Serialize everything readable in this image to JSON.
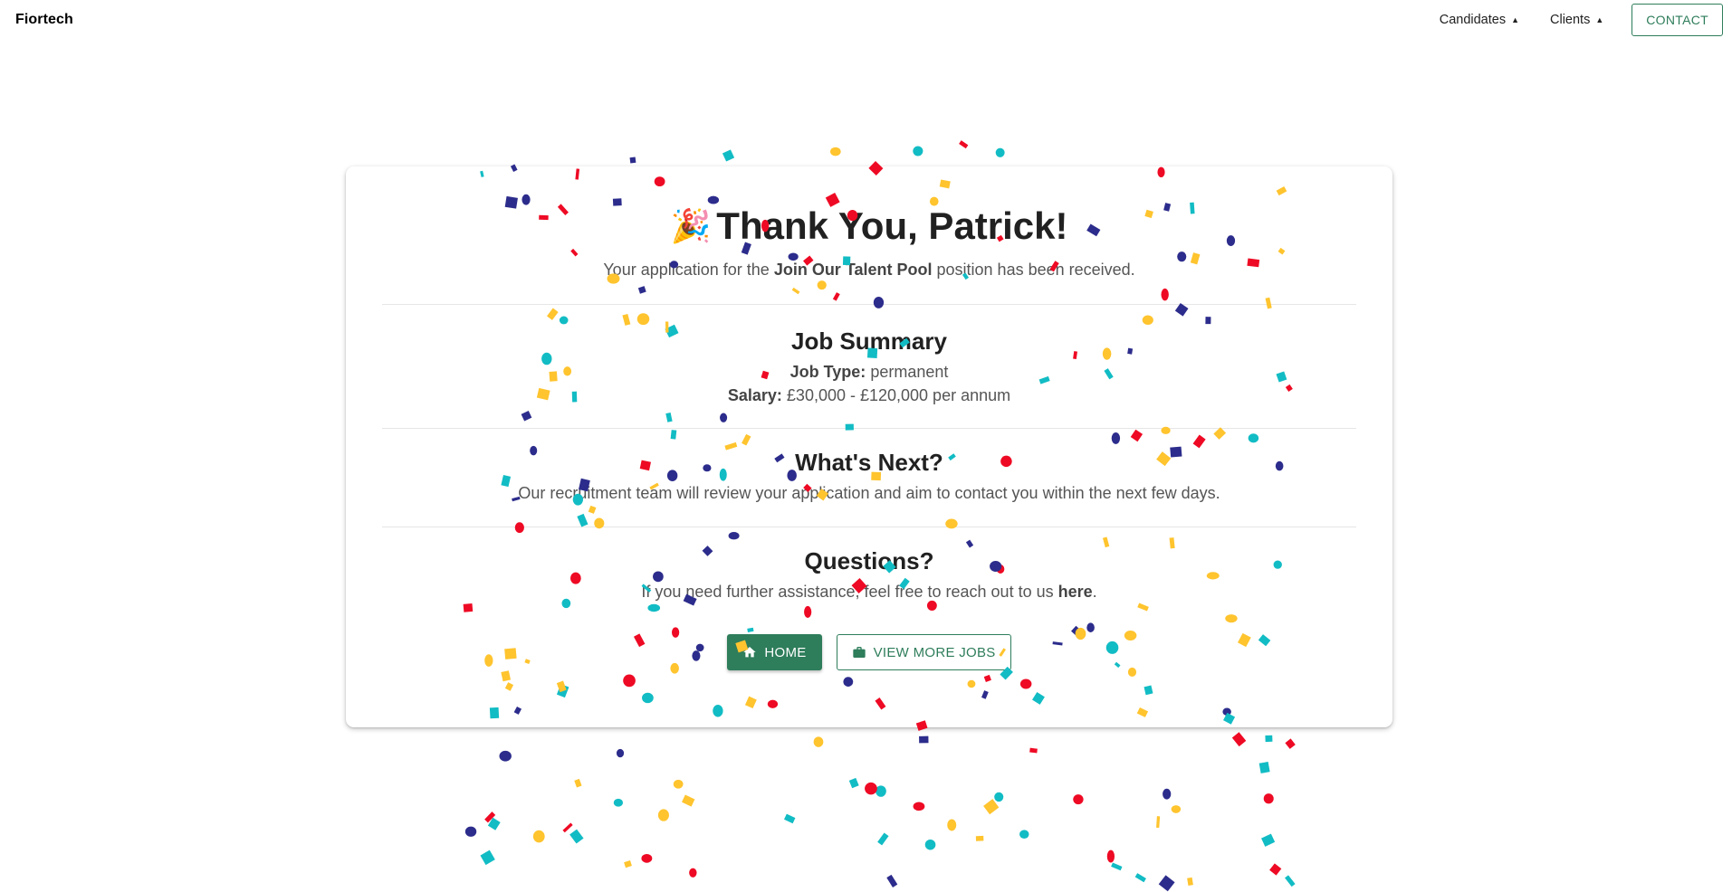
{
  "navbar": {
    "brand": "Fiortech",
    "candidates_label": "Candidates",
    "clients_label": "Clients",
    "contact_label": "CONTACT"
  },
  "card": {
    "title": "Thank You, Patrick!",
    "subtitle_prefix": "Your application for the",
    "subtitle_position": "Join Our Talent Pool",
    "subtitle_suffix": "position has been received.",
    "job_summary": {
      "heading": "Job Summary",
      "job_type_label": "Job Type:",
      "job_type_value": "permanent",
      "salary_label": "Salary:",
      "salary_value": "£30,000 - £120,000 per annum"
    },
    "whats_next": {
      "heading": "What's Next?",
      "text": "Our recruitment team will review your application and aim to contact you within the next few days."
    },
    "questions": {
      "heading": "Questions?",
      "text_prefix": "If you need further assistance, feel free to reach out to us",
      "link_text": "here",
      "text_suffix": "."
    },
    "buttons": {
      "home_label": "HOME",
      "view_jobs_label": "VIEW MORE JOBS"
    }
  },
  "icons": {
    "title_icon": "party-popper-icon",
    "home_icon": "home-icon",
    "jobs_icon": "briefcase-icon",
    "caret_icon": "caret-up-icon"
  },
  "colors": {
    "primary": "#2e7d5b",
    "confetti": [
      "#ee0a24",
      "#2c2c8c",
      "#12bcc4",
      "#ffc42e"
    ]
  }
}
